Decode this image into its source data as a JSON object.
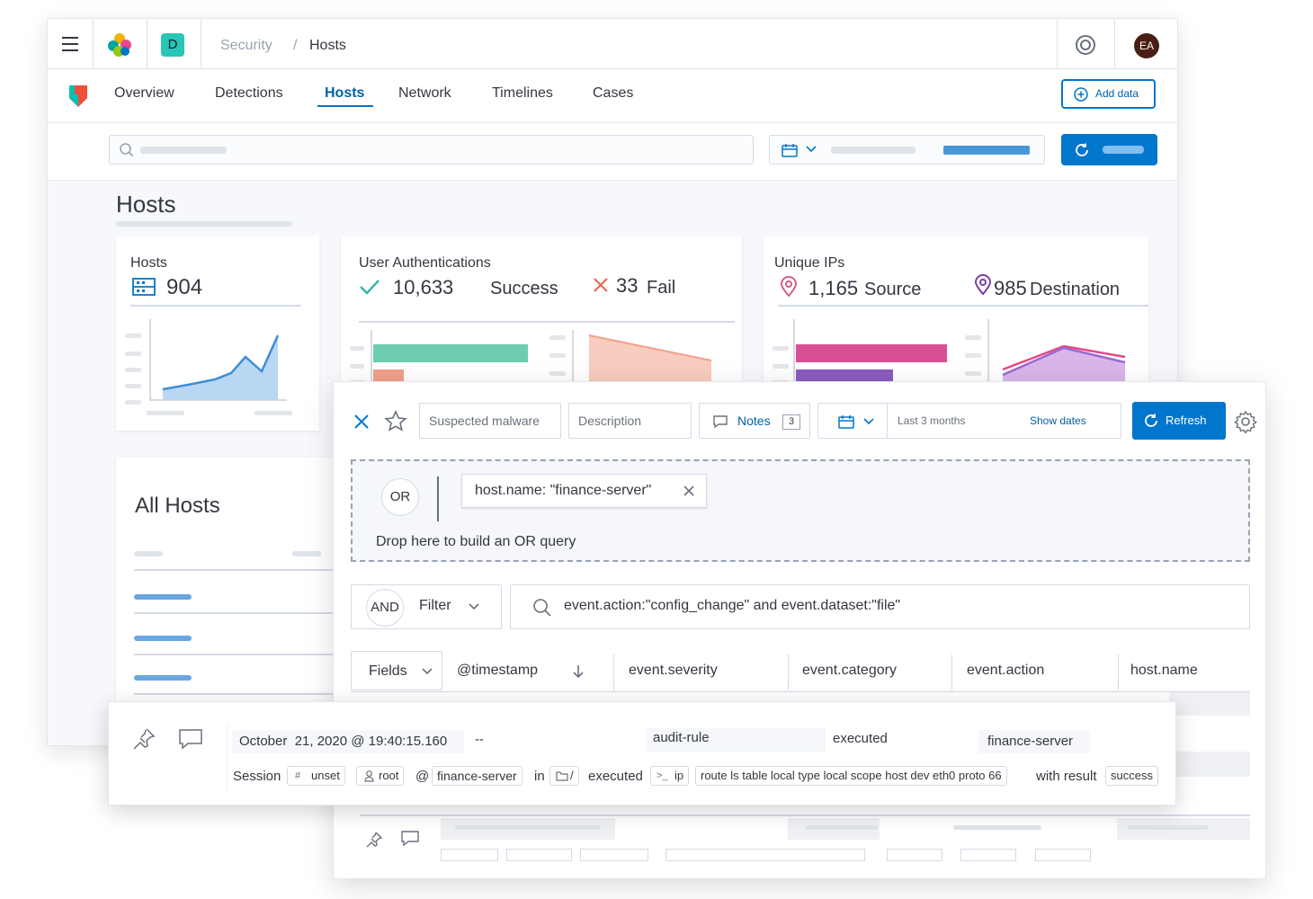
{
  "header": {
    "breadcrumb_parent": "Security",
    "breadcrumb_sep": "/",
    "breadcrumb_current": "Hosts",
    "space_letter": "D",
    "avatar": "EA"
  },
  "nav": {
    "tabs": [
      "Overview",
      "Detections",
      "Hosts",
      "Network",
      "Timelines",
      "Cases"
    ],
    "active": "Hosts",
    "add_data": "Add data"
  },
  "page": {
    "title": "Hosts"
  },
  "kpi_hosts": {
    "title": "Hosts",
    "value": "904"
  },
  "kpi_auth": {
    "title": "User Authentications",
    "success_value": "10,633",
    "success_label": "Success",
    "fail_value": "33",
    "fail_label": "Fail"
  },
  "kpi_ips": {
    "title": "Unique IPs",
    "source_value": "1,165",
    "source_label": "Source",
    "dest_value": "985",
    "dest_label": "Destination"
  },
  "all_hosts": {
    "title": "All Hosts"
  },
  "timeline": {
    "title_value": "Suspected malware",
    "description_placeholder": "Description",
    "notes_label": "Notes",
    "notes_count": "3",
    "date_range": "Last 3 months",
    "show_dates": "Show dates",
    "refresh": "Refresh",
    "or_badge": "OR",
    "or_pill": "host.name: \"finance-server\"",
    "drop_hint": "Drop here to build an OR query",
    "and_badge": "AND",
    "filter_label": "Filter",
    "query": "event.action:\"config_change\" and event.dataset:\"file\"",
    "fields_button": "Fields",
    "columns": [
      "@timestamp",
      "event.severity",
      "event.category",
      "event.action",
      "host.name"
    ]
  },
  "event_row": {
    "timestamp": "October  21, 2020 @ 19:40:15.160",
    "severity": "--",
    "category": "audit-rule",
    "action": "executed",
    "host": "finance-server",
    "session_label": "Session",
    "session_id": "unset",
    "user": "root",
    "at": "@",
    "host_chip": "finance-server",
    "in": "in",
    "dir": "/",
    "executed": "executed",
    "process": "ip",
    "args": "route ls table local type local scope host dev eth0 proto 66",
    "with_result": "with result",
    "result": "success"
  },
  "colors": {
    "accent": "#0077cc",
    "teal": "#54b399",
    "pink": "#d36086",
    "purple": "#9170b8",
    "salmon": "#f5a791"
  }
}
